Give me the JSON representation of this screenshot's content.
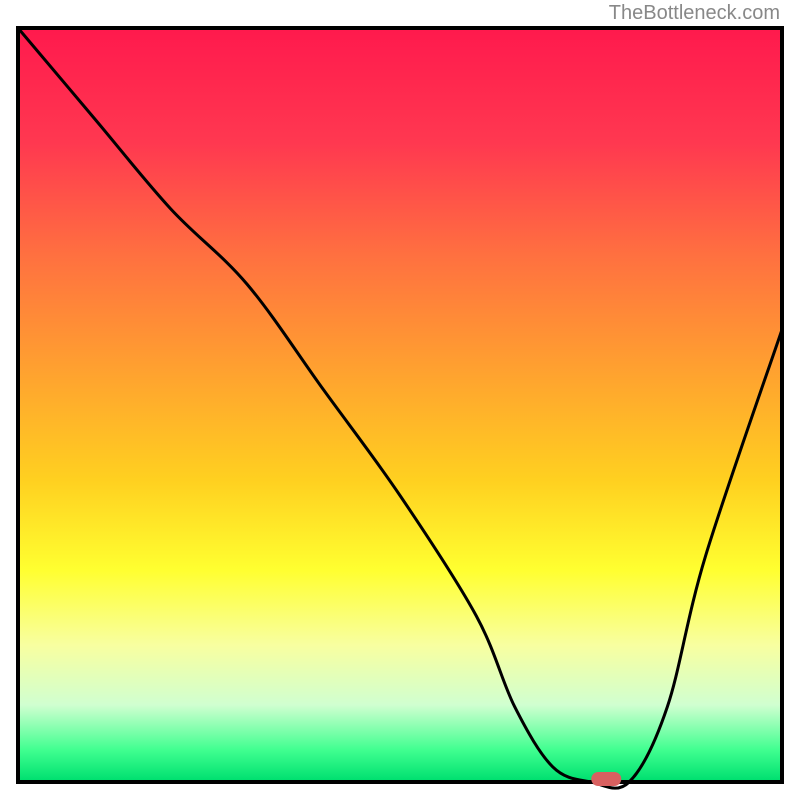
{
  "watermark": "TheBottleneck.com",
  "chart_data": {
    "type": "line",
    "title": "",
    "xlabel": "",
    "ylabel": "",
    "xlim": [
      0,
      100
    ],
    "ylim": [
      0,
      100
    ],
    "background_gradient": {
      "type": "vertical",
      "stops": [
        {
          "offset": 0,
          "color": "#ff1a4d"
        },
        {
          "offset": 15,
          "color": "#ff3850"
        },
        {
          "offset": 30,
          "color": "#ff7040"
        },
        {
          "offset": 45,
          "color": "#ffa030"
        },
        {
          "offset": 60,
          "color": "#ffd020"
        },
        {
          "offset": 72,
          "color": "#ffff30"
        },
        {
          "offset": 82,
          "color": "#f8ffa0"
        },
        {
          "offset": 90,
          "color": "#d0ffd0"
        },
        {
          "offset": 96,
          "color": "#40ff90"
        },
        {
          "offset": 100,
          "color": "#00e070"
        }
      ]
    },
    "series": [
      {
        "name": "bottleneck-curve",
        "color": "#000000",
        "x": [
          0,
          10,
          20,
          30,
          40,
          50,
          60,
          65,
          70,
          75,
          80,
          85,
          90,
          100
        ],
        "y": [
          100,
          88,
          76,
          66,
          52,
          38,
          22,
          10,
          2,
          0,
          0,
          10,
          30,
          60
        ]
      }
    ],
    "marker": {
      "name": "optimal-point",
      "x": 77,
      "y": 0,
      "color": "#d86060",
      "shape": "pill"
    },
    "frame_color": "#000000"
  }
}
